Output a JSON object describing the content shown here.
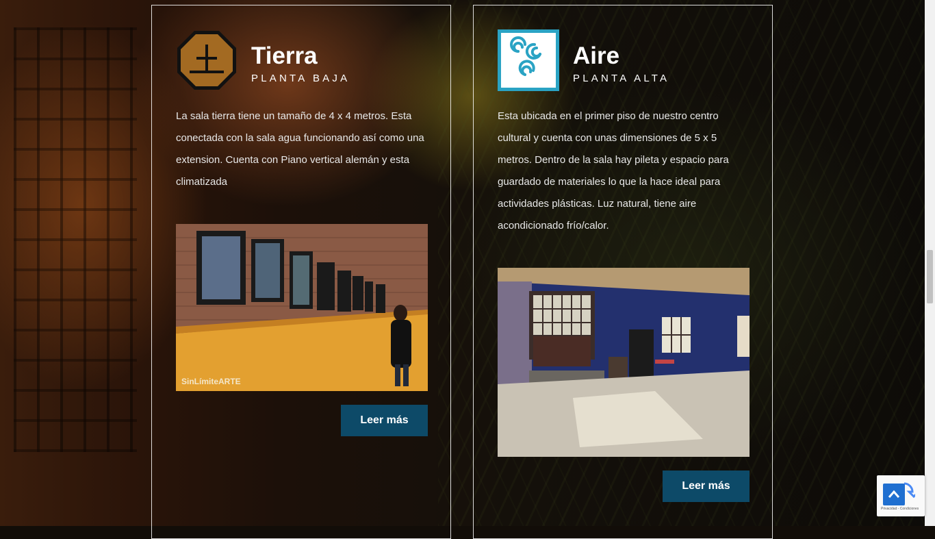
{
  "rooms": [
    {
      "title": "Tierra",
      "subtitle": "PLANTA BAJA",
      "description": "La sala tierra tiene un tamaño de 4 x 4 metros. Esta conectada con la sala agua funcionando así como una extension. Cuenta con Piano vertical alemán y esta climatizada",
      "photo_watermark": "SinLímiteARTE",
      "button_label": "Leer más",
      "icon": "earth-element-icon"
    },
    {
      "title": "Aire",
      "subtitle": "PLANTA ALTA",
      "description": "Esta ubicada en el primer piso de nuestro centro cultural y cuenta con unas dimensiones de 5 x 5 metros. Dentro de la sala hay pileta y espacio para guardado de materiales lo que la hace ideal para actividades plásticas. Luz natural, tiene aire acondicionado frío/calor.",
      "button_label": "Leer más",
      "icon": "air-element-icon"
    }
  ],
  "recaptcha": {
    "text": "Privacidad - Condiciones"
  },
  "colors": {
    "button": "#0d4a68",
    "accent_blue": "#1f6fd0",
    "earth_icon": "#a36a22",
    "air_icon": "#2aa3c4"
  }
}
